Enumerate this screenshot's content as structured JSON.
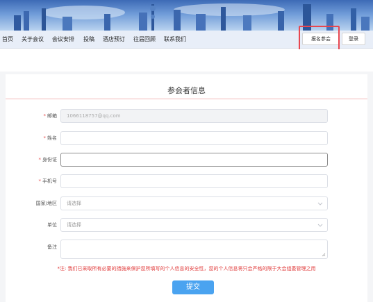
{
  "nav": {
    "items": [
      "首页",
      "关于会议",
      "会议安排",
      "投稿",
      "酒店预订",
      "往届回顾",
      "联系我们"
    ],
    "signup_label": "报名参会",
    "login_label": "登录"
  },
  "form": {
    "title": "参会者信息",
    "fields": {
      "email": {
        "label": "邮箱",
        "required": true,
        "value": "1066118757@qq.com"
      },
      "name": {
        "label": "姓名",
        "required": true,
        "value": ""
      },
      "id_card": {
        "label": "身份证",
        "required": true,
        "value": ""
      },
      "phone": {
        "label": "手机号",
        "required": true,
        "value": ""
      },
      "country": {
        "label": "国家/地区",
        "required": false,
        "placeholder": "请选择"
      },
      "unit": {
        "label": "单位",
        "required": false,
        "placeholder": "请选择"
      },
      "remark": {
        "label": "备注",
        "required": false,
        "value": ""
      }
    },
    "required_mark": "*",
    "notice": "*注: 我们已采取所有必要的措施来保护您所填写的个人信息的安全性，您的个人信息将只会严格的限于大会组委管理之用",
    "submit_label": "提交"
  },
  "colors": {
    "accent": "#4aa3f0",
    "required": "#e84c4c",
    "highlight": "#e8474f"
  }
}
